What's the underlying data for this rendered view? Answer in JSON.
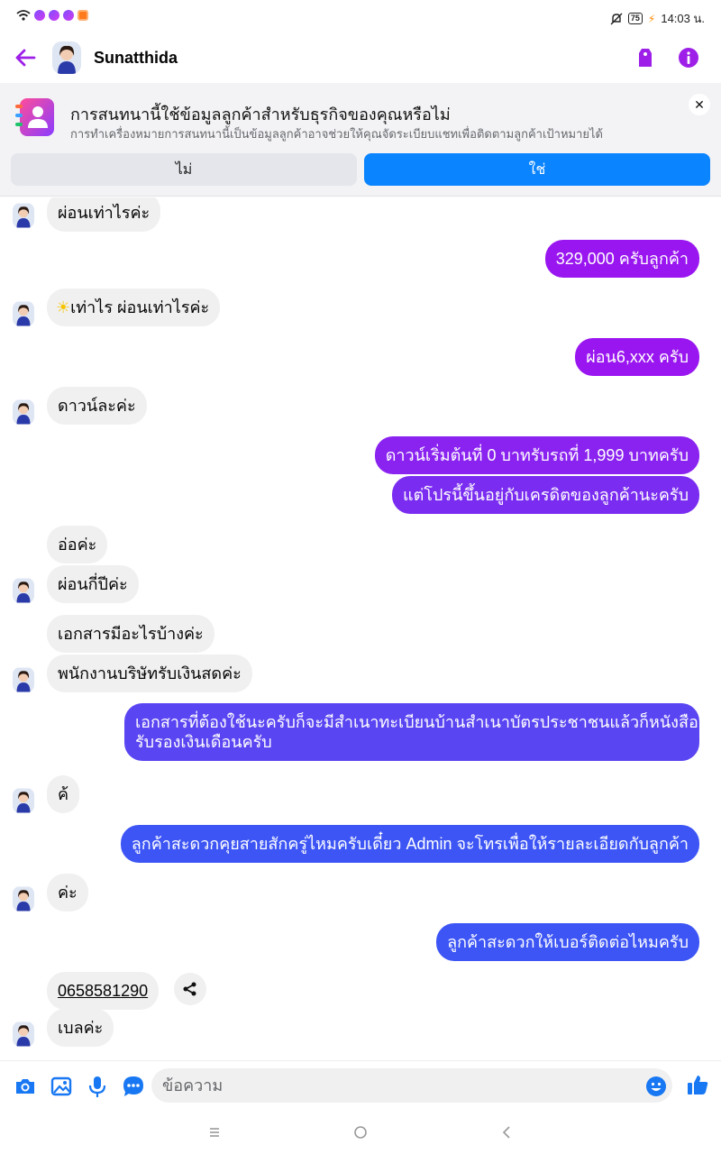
{
  "status": {
    "time": "14:03 น.",
    "battery": "75"
  },
  "header": {
    "name": "Sunatthida"
  },
  "banner": {
    "title": "การสนทนานี้ใช้ข้อมูลลูกค้าสำหรับธุรกิจของคุณหรือไม่",
    "subtitle": "การทำเครื่องหมายการสนทนานี้เป็นข้อมูลลูกค้าอาจช่วยให้คุณจัดระเบียบแชทเพื่อติดตามลูกค้าเป้าหมายได้",
    "no_label": "ไม่",
    "yes_label": "ใช่"
  },
  "messages": {
    "m1": "ผ่อนเท่าไรค่ะ",
    "m2": "329,000 ครับลูกค้า",
    "m3": "เท่าไร ผ่อนเท่าไรค่ะ",
    "m4": "ผ่อน6,xxx ครับ",
    "m5": "ดาวน์ละค่ะ",
    "m6": "ดาวน์เริ่มต้นที่ 0 บาทรับรถที่ 1,999 บาทครับ",
    "m7": "แต่โปรนี้ขึ้นอยู่กับเครดิตของลูกค้านะครับ",
    "m8": "อ่อค่ะ",
    "m9": "ผ่อนกี่ปีค่ะ",
    "m10": "เอกสารมีอะไรบ้างค่ะ",
    "m11": "พนักงานบริษัทรับเงินสดค่ะ",
    "m12_line1": "เอกสารที่ต้องใช้นะครับก็จะมีสำเนาทะเบียนบ้านสำเนาบัตรประชาชนแล้วก็หนังสือ",
    "m12_line2": "รับรองเงินเดือนครับ",
    "m13": "ค้ ",
    "m14": "ลูกค้าสะดวกคุยสายสักครู่ไหมครับเดี๋ยว Admin จะโทรเพื่อให้รายละเอียดกับลูกค้า",
    "m15": "ค่ะ",
    "m16": "ลูกค้าสะดวกให้เบอร์ติดต่อไหมครับ",
    "m17": "0658581290",
    "m18": "เบลค่ะ"
  },
  "composer": {
    "placeholder": "ข้อความ"
  },
  "colors": {
    "accent": "#9d1fe8",
    "purple_bubble": "#9a16f0",
    "violet_bubble": "#7a2df0",
    "indigo_bubble": "#5a45f2",
    "blue_bubble": "#3d55f5",
    "yes_button": "#0a84ff",
    "icon_blue": "#1877f2"
  }
}
